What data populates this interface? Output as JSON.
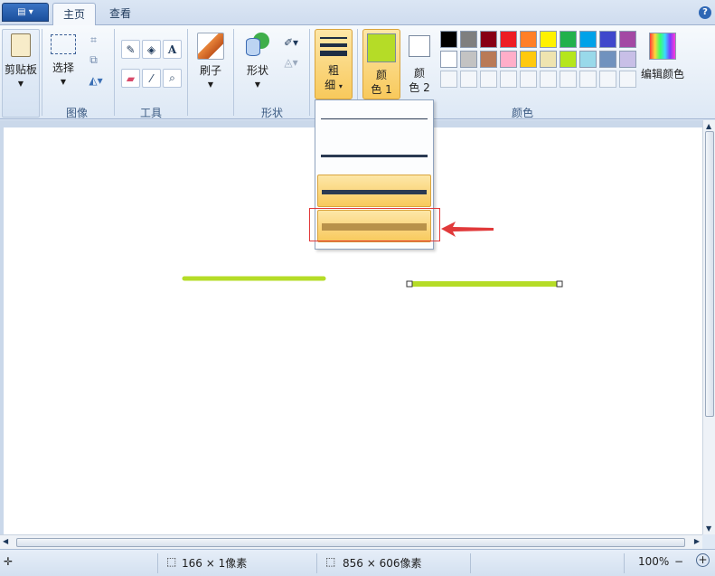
{
  "tabs": {
    "home": "主页",
    "view": "查看"
  },
  "ribbon": {
    "clipboard": {
      "label": "剪贴板"
    },
    "image": {
      "select_label": "选择",
      "group_label": "图像"
    },
    "tools": {
      "group_label": "工具",
      "text_glyph": "A"
    },
    "brushes": {
      "label": "刷子"
    },
    "shapes": {
      "label": "形状",
      "group_label": "形状"
    },
    "size": {
      "label_line1": "粗",
      "label_line2": "细"
    },
    "colors": {
      "color1_line1": "颜",
      "color1_line2": "色 1",
      "color2_line1": "颜",
      "color2_line2": "色 2",
      "edit_label": "编辑颜色",
      "group_label": "颜色",
      "current_color1": "#b5dc27",
      "current_color2": "#ffffff",
      "palette_row1": [
        "#000000",
        "#7f7f7f",
        "#880015",
        "#ed1c24",
        "#ff7f27",
        "#fff200",
        "#22b14c",
        "#00a2e8",
        "#3f48cc",
        "#a349a4"
      ],
      "palette_row2": [
        "#ffffff",
        "#c3c3c3",
        "#b97a57",
        "#ffaec9",
        "#ffc90e",
        "#efe4b0",
        "#b5e61d",
        "#99d9ea",
        "#7092be",
        "#c8bfe7"
      ]
    }
  },
  "size_dropdown": {
    "options": [
      "1px",
      "3px",
      "5px",
      "8px"
    ],
    "selected_index": 2,
    "hovered_index": 3
  },
  "canvas": {
    "stroke_color": "#b5dc27"
  },
  "statusbar": {
    "selection_size": "166 × 1像素",
    "canvas_size": "856 × 606像素",
    "zoom": "100%"
  }
}
